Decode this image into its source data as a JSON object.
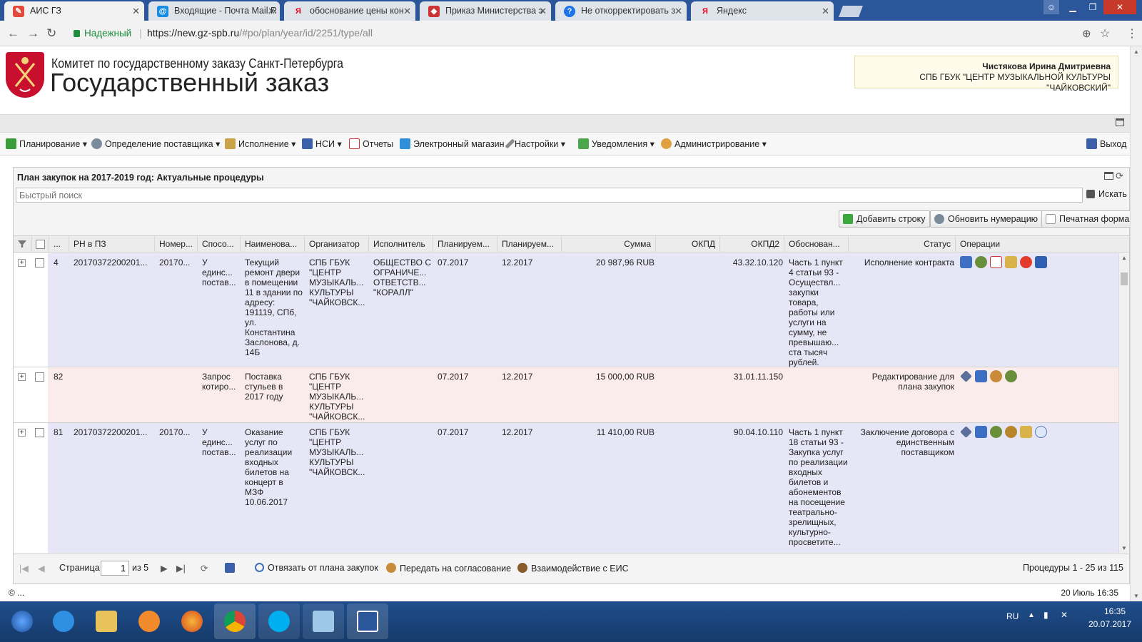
{
  "browser": {
    "tabs": [
      {
        "title": "АИС ГЗ",
        "active": true
      },
      {
        "title": "Входящие - Почта Mail.R",
        "active": false
      },
      {
        "title": "обоснование цены кон",
        "active": false
      },
      {
        "title": "Приказ Министерства э",
        "active": false
      },
      {
        "title": "Не откорректировать з",
        "active": false
      },
      {
        "title": "Яндекс",
        "active": false
      }
    ],
    "secure_label": "Надежный",
    "url_host": "https://new.gz-spb.ru",
    "url_path": "/#po/plan/year/id/2251/type/all"
  },
  "header": {
    "org_name": "Комитет по государственному заказу Санкт-Петербурга",
    "site_title": "Государственный заказ",
    "user_name": "Чистякова Ирина Дмитриевна",
    "user_org": "СПБ ГБУК \"ЦЕНТР МУЗЫКАЛЬНОЙ КУЛЬТУРЫ \"ЧАЙКОВСКИЙ\""
  },
  "menu": {
    "items": [
      {
        "label": "Планирование",
        "dropdown": true,
        "icon": "planning-icon"
      },
      {
        "label": "Определение поставщика",
        "dropdown": true,
        "icon": "gears-icon"
      },
      {
        "label": "Исполнение",
        "dropdown": true,
        "icon": "execution-icon"
      },
      {
        "label": "НСИ",
        "dropdown": true,
        "icon": "book-icon"
      },
      {
        "label": "Отчеты",
        "dropdown": false,
        "icon": "report-icon"
      },
      {
        "label": "Электронный магазин",
        "dropdown": false,
        "icon": "cart-icon"
      },
      {
        "label": "Настройки",
        "dropdown": true,
        "icon": "wrench-icon"
      },
      {
        "label": "Уведомления",
        "dropdown": true,
        "icon": "notification-icon"
      },
      {
        "label": "Администрирование",
        "dropdown": true,
        "icon": "user-icon"
      }
    ],
    "logout": "Выход"
  },
  "panel": {
    "title": "План закупок на 2017-2019 год: Актуальные процедуры",
    "search_placeholder": "Быстрый поиск",
    "search_button": "Искать",
    "toolbar": {
      "add_row": "Добавить строку",
      "renumber": "Обновить нумерацию",
      "print_form": "Печатная форма"
    }
  },
  "grid": {
    "columns": [
      "...",
      "РН в ПЗ",
      "Номер...",
      "Спосо...",
      "Наименова...",
      "Организатор",
      "Исполнитель",
      "Планируем...",
      "Планируем...",
      "Сумма",
      "ОКПД",
      "ОКПД2",
      "Обоснован...",
      "Статус",
      "Операции"
    ],
    "rows": [
      {
        "num": "4",
        "rn": "20170372200201...",
        "number": "20170...",
        "method": "У единс... постав...",
        "name": "Текущий ремонт двери в помещении 11 в здании по адресу: 191119, СПб, ул. Константина Заслонова, д. 14Б",
        "organizer": "СПБ ГБУК \"ЦЕНТР МУЗЫКАЛЬ... КУЛЬТУРЫ \"ЧАЙКОВСК...",
        "executor": "ОБЩЕСТВО С ОГРАНИЧЕ... ОТВЕТСТВ... \"КОРАЛЛ\"",
        "plan1": "07.2017",
        "plan2": "12.2017",
        "sum": "20 987,96 RUB",
        "okpd": "",
        "okpd2": "43.32.10.120",
        "basis": "Часть 1 пункт 4 статьи 93 - Осуществл... закупки товара, работы или услуги на сумму, не превышаю... ста тысяч рублей.",
        "status": "Исполнение контракта",
        "ops": [
          "chart-icon",
          "gear-icon",
          "document-icon",
          "hand-icon",
          "red-circle-icon",
          "bars-icon"
        ],
        "bg": "#e6e6f7"
      },
      {
        "num": "82",
        "rn": "",
        "number": "",
        "method": "Запрос котиро...",
        "name": "Поставка стульев в 2017 году",
        "organizer": "СПБ ГБУК \"ЦЕНТР МУЗЫКАЛЬ... КУЛЬТУРЫ \"ЧАЙКОВСК...",
        "executor": "",
        "plan1": "07.2017",
        "plan2": "12.2017",
        "sum": "15 000,00 RUB",
        "okpd": "",
        "okpd2": "31.01.11.150",
        "basis": "",
        "status": "Редактирование для плана закупок",
        "ops": [
          "pencil-icon",
          "chart-icon",
          "people-icon",
          "gear-icon"
        ],
        "bg": "#fbecec"
      },
      {
        "num": "81",
        "rn": "20170372200201...",
        "number": "20170...",
        "method": "У единс... постав...",
        "name": "Оказание услуг по реализации входных билетов на концерт в МЗФ 10.06.2017",
        "organizer": "СПБ ГБУК \"ЦЕНТР МУЗЫКАЛЬ... КУЛЬТУРЫ \"ЧАЙКОВСК...",
        "executor": "",
        "plan1": "07.2017",
        "plan2": "12.2017",
        "sum": "11 410,00 RUB",
        "okpd": "",
        "okpd2": "90.04.10.110",
        "basis": "Часть 1 пункт 18 статьи 93 - Закупка услуг по реализации входных билетов и абонементов на посещение театрально-зрелищных, культурно-просветите...",
        "status": "Заключение договора с единственным поставщиком",
        "ops": [
          "pencil-icon",
          "chart-icon",
          "gear-icon",
          "emblem-icon",
          "scroll-icon",
          "info-icon"
        ],
        "bg": "#e6e6f7"
      }
    ]
  },
  "pager": {
    "page_label": "Страница",
    "page_value": "1",
    "of_label": "из 5",
    "unlink": "Отвязать от плана закупок",
    "send_approval": "Передать на согласование",
    "eis": "Взаимодействие с ЕИС",
    "summary": "Процедуры 1 - 25 из 115"
  },
  "footer": {
    "copyright": "© ...",
    "datetime": "20 Июль 16:35"
  },
  "taskbar": {
    "lang": "RU",
    "time": "16:35",
    "date": "20.07.2017"
  },
  "colors": {
    "accent_blue": "#2b579a",
    "row_blue": "#e6e6f7",
    "row_pink": "#fbecec",
    "secure_green": "#1e8e3e"
  }
}
